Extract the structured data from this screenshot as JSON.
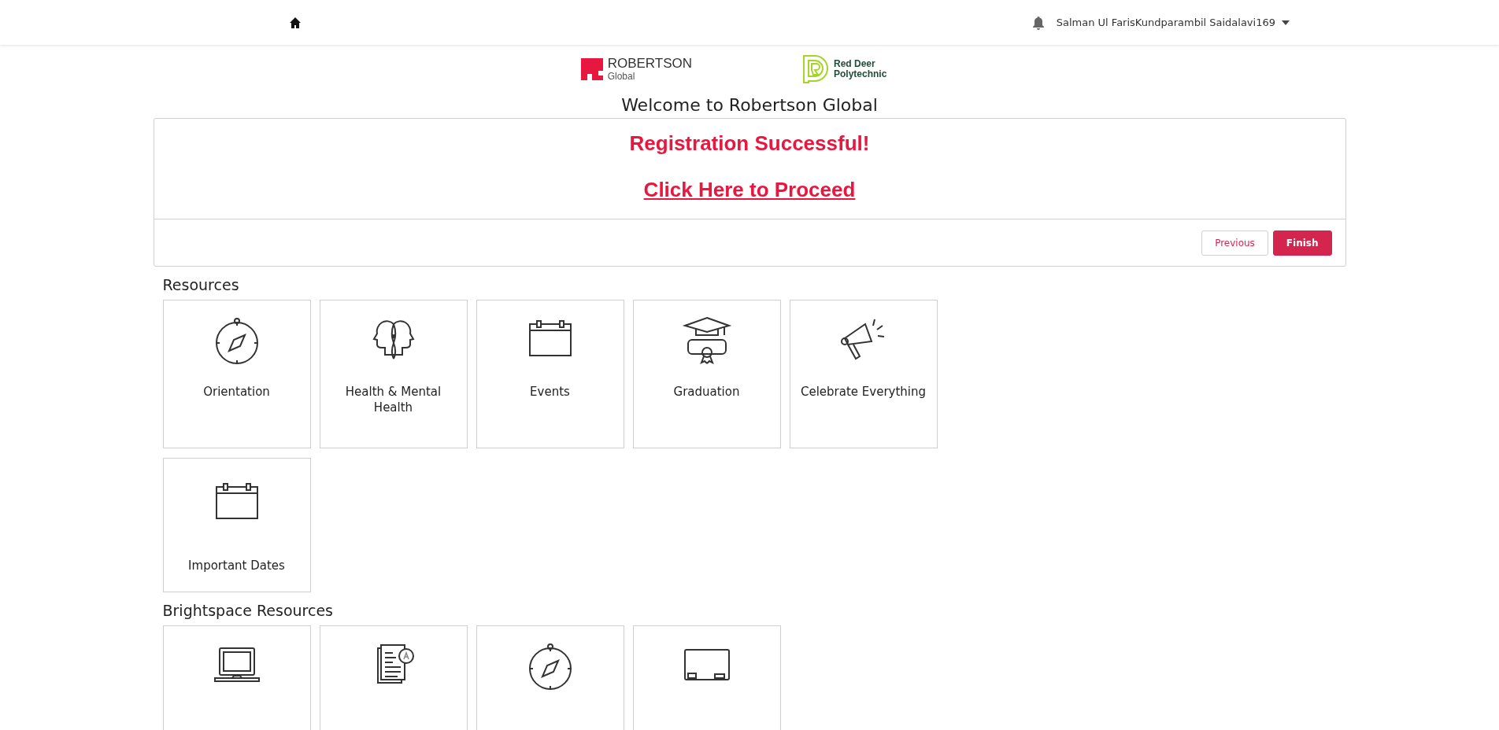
{
  "top_bar": {
    "user_name": "Salman Ul FarisKundparambil Saidalavi169"
  },
  "logos": [
    {
      "kind": "robertson",
      "name": "ROBERTSON",
      "subtitle": "Global"
    },
    {
      "kind": "rdp",
      "name": "Red Deer",
      "subtitle": "Polytechnic"
    }
  ],
  "title": "Welcome to Robertson Global",
  "panel": {
    "message": "Registration Successful!",
    "link": "Click Here to Proceed",
    "buttons": [
      {
        "label": "Previous",
        "kind": "secondary"
      },
      {
        "label": "Finish",
        "kind": "primary"
      }
    ]
  },
  "sections": [
    {
      "heading": "Resources",
      "tiles": [
        {
          "kind": "compass",
          "label": "Orientation"
        },
        {
          "kind": "heads",
          "label": "Health & Mental Health"
        },
        {
          "kind": "calendar",
          "label": "Events"
        },
        {
          "kind": "graduation",
          "label": "Graduation"
        },
        {
          "kind": "megaphone",
          "label": "Celebrate Everything"
        },
        {
          "kind": "calendar",
          "label": "Important Dates"
        }
      ]
    },
    {
      "heading": "Brightspace Resources",
      "tiles": [
        {
          "kind": "laptop"
        },
        {
          "kind": "document"
        },
        {
          "kind": "compass"
        },
        {
          "kind": "blackboard"
        }
      ]
    }
  ]
}
